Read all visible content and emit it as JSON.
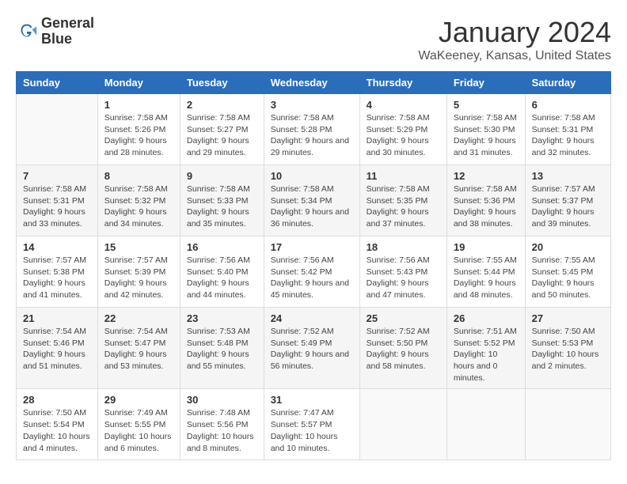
{
  "logo": {
    "line1": "General",
    "line2": "Blue"
  },
  "title": "January 2024",
  "subtitle": "WaKeeney, Kansas, United States",
  "weekdays": [
    "Sunday",
    "Monday",
    "Tuesday",
    "Wednesday",
    "Thursday",
    "Friday",
    "Saturday"
  ],
  "weeks": [
    [
      {
        "day": "",
        "sunrise": "",
        "sunset": "",
        "daylight": ""
      },
      {
        "day": "1",
        "sunrise": "Sunrise: 7:58 AM",
        "sunset": "Sunset: 5:26 PM",
        "daylight": "Daylight: 9 hours and 28 minutes."
      },
      {
        "day": "2",
        "sunrise": "Sunrise: 7:58 AM",
        "sunset": "Sunset: 5:27 PM",
        "daylight": "Daylight: 9 hours and 29 minutes."
      },
      {
        "day": "3",
        "sunrise": "Sunrise: 7:58 AM",
        "sunset": "Sunset: 5:28 PM",
        "daylight": "Daylight: 9 hours and 29 minutes."
      },
      {
        "day": "4",
        "sunrise": "Sunrise: 7:58 AM",
        "sunset": "Sunset: 5:29 PM",
        "daylight": "Daylight: 9 hours and 30 minutes."
      },
      {
        "day": "5",
        "sunrise": "Sunrise: 7:58 AM",
        "sunset": "Sunset: 5:30 PM",
        "daylight": "Daylight: 9 hours and 31 minutes."
      },
      {
        "day": "6",
        "sunrise": "Sunrise: 7:58 AM",
        "sunset": "Sunset: 5:31 PM",
        "daylight": "Daylight: 9 hours and 32 minutes."
      }
    ],
    [
      {
        "day": "7",
        "sunrise": "Sunrise: 7:58 AM",
        "sunset": "Sunset: 5:31 PM",
        "daylight": "Daylight: 9 hours and 33 minutes."
      },
      {
        "day": "8",
        "sunrise": "Sunrise: 7:58 AM",
        "sunset": "Sunset: 5:32 PM",
        "daylight": "Daylight: 9 hours and 34 minutes."
      },
      {
        "day": "9",
        "sunrise": "Sunrise: 7:58 AM",
        "sunset": "Sunset: 5:33 PM",
        "daylight": "Daylight: 9 hours and 35 minutes."
      },
      {
        "day": "10",
        "sunrise": "Sunrise: 7:58 AM",
        "sunset": "Sunset: 5:34 PM",
        "daylight": "Daylight: 9 hours and 36 minutes."
      },
      {
        "day": "11",
        "sunrise": "Sunrise: 7:58 AM",
        "sunset": "Sunset: 5:35 PM",
        "daylight": "Daylight: 9 hours and 37 minutes."
      },
      {
        "day": "12",
        "sunrise": "Sunrise: 7:58 AM",
        "sunset": "Sunset: 5:36 PM",
        "daylight": "Daylight: 9 hours and 38 minutes."
      },
      {
        "day": "13",
        "sunrise": "Sunrise: 7:57 AM",
        "sunset": "Sunset: 5:37 PM",
        "daylight": "Daylight: 9 hours and 39 minutes."
      }
    ],
    [
      {
        "day": "14",
        "sunrise": "Sunrise: 7:57 AM",
        "sunset": "Sunset: 5:38 PM",
        "daylight": "Daylight: 9 hours and 41 minutes."
      },
      {
        "day": "15",
        "sunrise": "Sunrise: 7:57 AM",
        "sunset": "Sunset: 5:39 PM",
        "daylight": "Daylight: 9 hours and 42 minutes."
      },
      {
        "day": "16",
        "sunrise": "Sunrise: 7:56 AM",
        "sunset": "Sunset: 5:40 PM",
        "daylight": "Daylight: 9 hours and 44 minutes."
      },
      {
        "day": "17",
        "sunrise": "Sunrise: 7:56 AM",
        "sunset": "Sunset: 5:42 PM",
        "daylight": "Daylight: 9 hours and 45 minutes."
      },
      {
        "day": "18",
        "sunrise": "Sunrise: 7:56 AM",
        "sunset": "Sunset: 5:43 PM",
        "daylight": "Daylight: 9 hours and 47 minutes."
      },
      {
        "day": "19",
        "sunrise": "Sunrise: 7:55 AM",
        "sunset": "Sunset: 5:44 PM",
        "daylight": "Daylight: 9 hours and 48 minutes."
      },
      {
        "day": "20",
        "sunrise": "Sunrise: 7:55 AM",
        "sunset": "Sunset: 5:45 PM",
        "daylight": "Daylight: 9 hours and 50 minutes."
      }
    ],
    [
      {
        "day": "21",
        "sunrise": "Sunrise: 7:54 AM",
        "sunset": "Sunset: 5:46 PM",
        "daylight": "Daylight: 9 hours and 51 minutes."
      },
      {
        "day": "22",
        "sunrise": "Sunrise: 7:54 AM",
        "sunset": "Sunset: 5:47 PM",
        "daylight": "Daylight: 9 hours and 53 minutes."
      },
      {
        "day": "23",
        "sunrise": "Sunrise: 7:53 AM",
        "sunset": "Sunset: 5:48 PM",
        "daylight": "Daylight: 9 hours and 55 minutes."
      },
      {
        "day": "24",
        "sunrise": "Sunrise: 7:52 AM",
        "sunset": "Sunset: 5:49 PM",
        "daylight": "Daylight: 9 hours and 56 minutes."
      },
      {
        "day": "25",
        "sunrise": "Sunrise: 7:52 AM",
        "sunset": "Sunset: 5:50 PM",
        "daylight": "Daylight: 9 hours and 58 minutes."
      },
      {
        "day": "26",
        "sunrise": "Sunrise: 7:51 AM",
        "sunset": "Sunset: 5:52 PM",
        "daylight": "Daylight: 10 hours and 0 minutes."
      },
      {
        "day": "27",
        "sunrise": "Sunrise: 7:50 AM",
        "sunset": "Sunset: 5:53 PM",
        "daylight": "Daylight: 10 hours and 2 minutes."
      }
    ],
    [
      {
        "day": "28",
        "sunrise": "Sunrise: 7:50 AM",
        "sunset": "Sunset: 5:54 PM",
        "daylight": "Daylight: 10 hours and 4 minutes."
      },
      {
        "day": "29",
        "sunrise": "Sunrise: 7:49 AM",
        "sunset": "Sunset: 5:55 PM",
        "daylight": "Daylight: 10 hours and 6 minutes."
      },
      {
        "day": "30",
        "sunrise": "Sunrise: 7:48 AM",
        "sunset": "Sunset: 5:56 PM",
        "daylight": "Daylight: 10 hours and 8 minutes."
      },
      {
        "day": "31",
        "sunrise": "Sunrise: 7:47 AM",
        "sunset": "Sunset: 5:57 PM",
        "daylight": "Daylight: 10 hours and 10 minutes."
      },
      {
        "day": "",
        "sunrise": "",
        "sunset": "",
        "daylight": ""
      },
      {
        "day": "",
        "sunrise": "",
        "sunset": "",
        "daylight": ""
      },
      {
        "day": "",
        "sunrise": "",
        "sunset": "",
        "daylight": ""
      }
    ]
  ]
}
